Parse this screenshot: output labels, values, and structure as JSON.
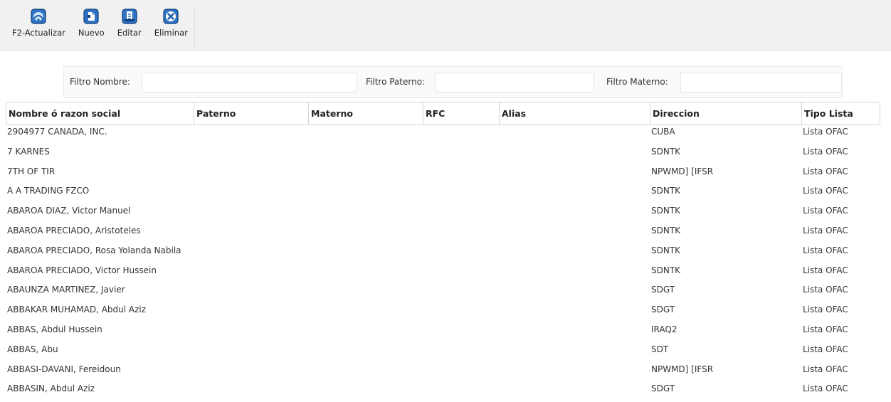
{
  "toolbar": {
    "buttons": [
      {
        "label": "F2-Actualizar",
        "icon": "refresh-icon"
      },
      {
        "label": "Nuevo",
        "icon": "new-document-icon"
      },
      {
        "label": "Editar",
        "icon": "edit-document-icon"
      },
      {
        "label": "Eliminar",
        "icon": "delete-icon"
      }
    ]
  },
  "filters": {
    "nombre_label": "Filtro Nombre:",
    "nombre_value": "",
    "paterno_label": "Filtro Paterno:",
    "paterno_value": "",
    "materno_label": "Filtro Materno:",
    "materno_value": ""
  },
  "table": {
    "headers": [
      "Nombre ó razon social",
      "Paterno",
      "Materno",
      "RFC",
      "Alias",
      "Direccion",
      "Tipo Lista"
    ],
    "rows": [
      [
        "2904977 CANADA, INC.",
        "",
        "",
        "",
        "",
        "CUBA",
        "Lista OFAC"
      ],
      [
        "7 KARNES",
        "",
        "",
        "",
        "",
        "SDNTK",
        "Lista OFAC"
      ],
      [
        "7TH OF TIR",
        "",
        "",
        "",
        "",
        "NPWMD] [IFSR",
        "Lista OFAC"
      ],
      [
        "A A TRADING FZCO",
        "",
        "",
        "",
        "",
        "SDNTK",
        "Lista OFAC"
      ],
      [
        "ABAROA DIAZ, Victor Manuel",
        "",
        "",
        "",
        "",
        "SDNTK",
        "Lista OFAC"
      ],
      [
        "ABAROA PRECIADO, Aristoteles",
        "",
        "",
        "",
        "",
        "SDNTK",
        "Lista OFAC"
      ],
      [
        "ABAROA PRECIADO, Rosa Yolanda Nabila",
        "",
        "",
        "",
        "",
        "SDNTK",
        "Lista OFAC"
      ],
      [
        "ABAROA PRECIADO, Victor Hussein",
        "",
        "",
        "",
        "",
        "SDNTK",
        "Lista OFAC"
      ],
      [
        "ABAUNZA MARTINEZ, Javier",
        "",
        "",
        "",
        "",
        "SDGT",
        "Lista OFAC"
      ],
      [
        "ABBAKAR MUHAMAD, Abdul Aziz",
        "",
        "",
        "",
        "",
        "SDGT",
        "Lista OFAC"
      ],
      [
        "ABBAS, Abdul Hussein",
        "",
        "",
        "",
        "",
        "IRAQ2",
        "Lista OFAC"
      ],
      [
        "ABBAS, Abu",
        "",
        "",
        "",
        "",
        "SDT",
        "Lista OFAC"
      ],
      [
        "ABBASI-DAVANI, Fereidoun",
        "",
        "",
        "",
        "",
        "NPWMD] [IFSR",
        "Lista OFAC"
      ],
      [
        "ABBASIN, Abdul Aziz",
        "",
        "",
        "",
        "",
        "SDGT",
        "Lista OFAC"
      ]
    ]
  },
  "colors": {
    "toolbar_bg": "#f1f1f1",
    "icon_blue": "#1f5fa8",
    "icon_border": "#0d3d78",
    "grid_border": "#d6d6d6"
  }
}
